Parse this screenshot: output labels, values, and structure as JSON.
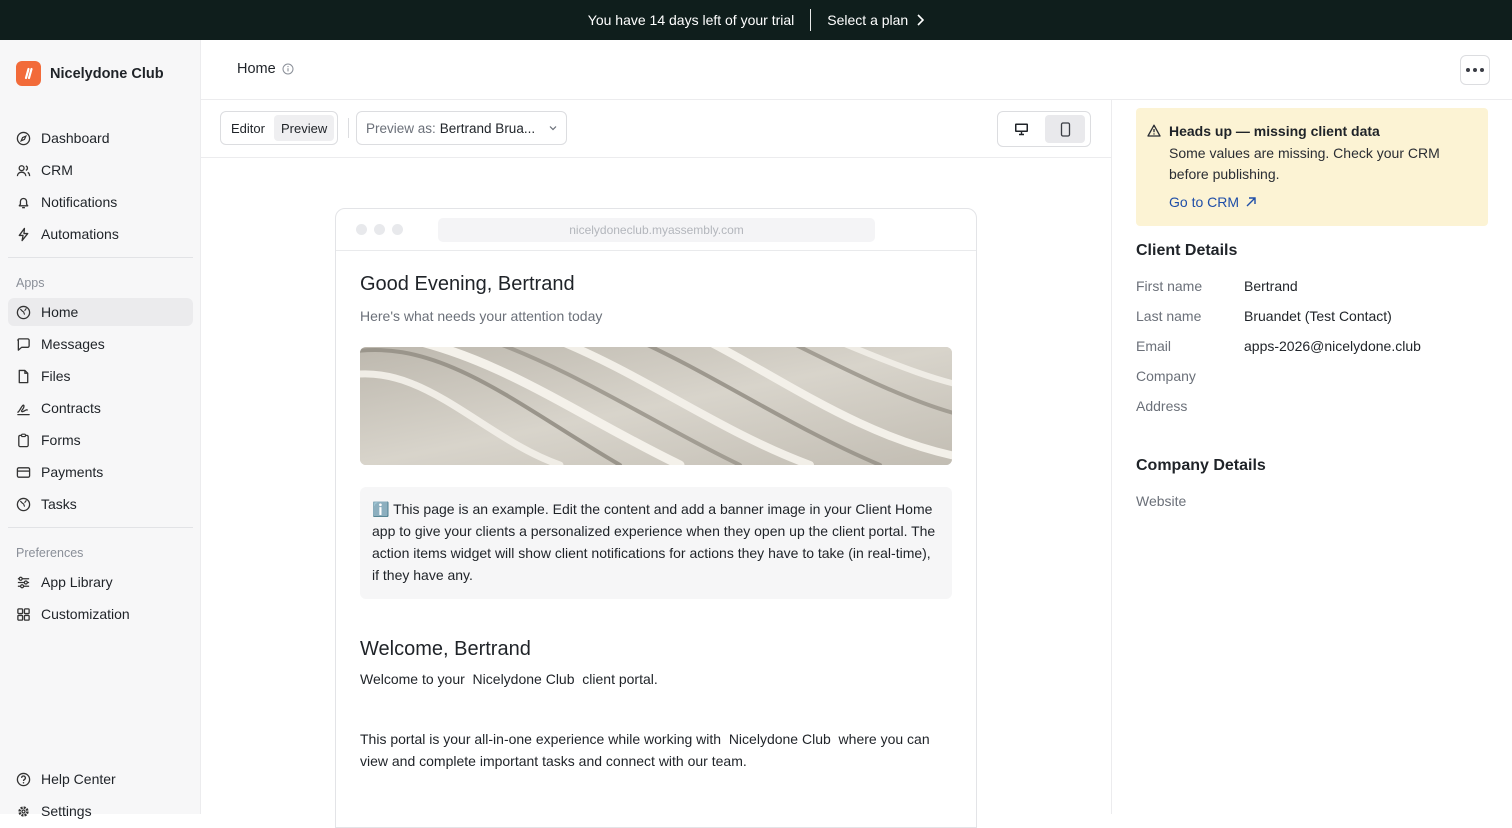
{
  "trial": {
    "message": "You have 14 days left of your trial",
    "cta": "Select a plan"
  },
  "sidebar": {
    "brand": "Nicelydone Club",
    "main_items": [
      {
        "label": "Dashboard",
        "icon": "compass-icon"
      },
      {
        "label": "CRM",
        "icon": "users-icon"
      },
      {
        "label": "Notifications",
        "icon": "bell-icon"
      },
      {
        "label": "Automations",
        "icon": "bolt-icon"
      }
    ],
    "apps_label": "Apps",
    "app_items": [
      {
        "label": "Home",
        "icon": "globe-icon"
      },
      {
        "label": "Messages",
        "icon": "chat-icon"
      },
      {
        "label": "Files",
        "icon": "file-icon"
      },
      {
        "label": "Contracts",
        "icon": "signature-icon"
      },
      {
        "label": "Forms",
        "icon": "clipboard-icon"
      },
      {
        "label": "Payments",
        "icon": "card-icon"
      },
      {
        "label": "Tasks",
        "icon": "globe-icon"
      }
    ],
    "preferences_label": "Preferences",
    "pref_items": [
      {
        "label": "App Library",
        "icon": "sliders-icon"
      },
      {
        "label": "Customization",
        "icon": "grid-icon"
      }
    ],
    "footer_items": [
      {
        "label": "Help Center",
        "icon": "help-icon"
      },
      {
        "label": "Settings",
        "icon": "gear-icon"
      }
    ]
  },
  "header": {
    "title": "Home"
  },
  "toolbar": {
    "editor_label": "Editor",
    "preview_label": "Preview",
    "preview_as_label": "Preview as:",
    "preview_as_value": "Bertrand Brua..."
  },
  "preview": {
    "url": "nicelydoneclub.myassembly.com",
    "greeting": "Good Evening, Bertrand",
    "subtitle": "Here's what needs your attention today",
    "info_emoji": "ℹ️",
    "info_text": "This page is an example. Edit the content and add a banner image in your Client Home app to give your clients a personalized experience when they open up the client portal. The action items widget will show client notifications for actions they have to take (in real-time), if they have any.",
    "welcome_title": "Welcome, Bertrand",
    "welcome_text": "Welcome to your  Nicelydone Club  client portal.",
    "portal_text": "This portal is your all-in-one experience while working with  Nicelydone Club  where you can view and complete important tasks and connect with our team."
  },
  "alert": {
    "title": "Heads up — missing client data",
    "body": "Some values are missing. Check your CRM before publishing.",
    "link": "Go to CRM"
  },
  "client_details": {
    "heading": "Client Details",
    "first_name_label": "First name",
    "first_name": "Bertrand",
    "last_name_label": "Last name",
    "last_name": "Bruandet (Test Contact)",
    "email_label": "Email",
    "email": "apps-2026@nicelydone.club",
    "company_label": "Company",
    "company": "",
    "address_label": "Address",
    "address": ""
  },
  "company_details": {
    "heading": "Company Details",
    "website_label": "Website",
    "website": ""
  },
  "colors": {
    "trial_bg": "#0f1e1c",
    "brand": "#f26b3a",
    "alert_bg": "#fcf3d4",
    "link": "#1f4ea8"
  }
}
